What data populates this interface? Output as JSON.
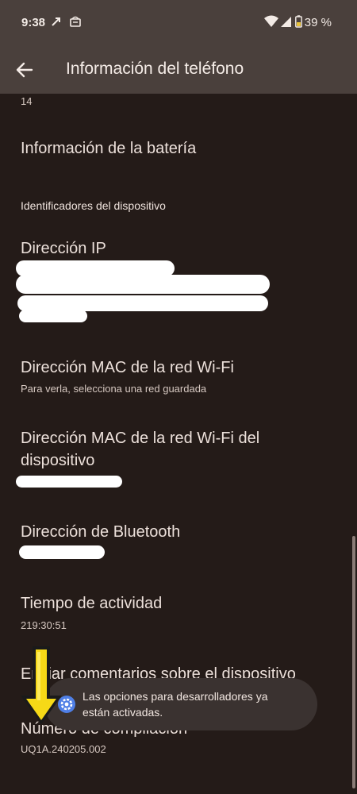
{
  "status_bar": {
    "time": "9:38",
    "battery_percent": "39 %"
  },
  "app_bar": {
    "title": "Información del teléfono"
  },
  "list": {
    "partial_value": "14",
    "battery_info": "Información de la batería",
    "section_header": "Identificadores del dispositivo",
    "ip_address": "Dirección IP",
    "wifi_mac": "Dirección MAC de la red Wi-Fi",
    "wifi_mac_summary": "Para verla, selecciona una red guardada",
    "device_wifi_mac_line1": "Dirección MAC de la red Wi-Fi del",
    "device_wifi_mac_line2": "dispositivo",
    "bluetooth_address": "Dirección de Bluetooth",
    "uptime": "Tiempo de actividad",
    "uptime_value": "219:30:51",
    "feedback": "Enviar comentarios sobre el dispositivo",
    "build_number": "Número de compilación",
    "build_value": "UQ1A.240205.002"
  },
  "toast": {
    "line1": "Las opciones para desarrolladores ya",
    "line2": "están activadas."
  },
  "colors": {
    "background": "#241b18",
    "app_bar": "#4a403c",
    "toast": "#3a3230",
    "accent_blue": "#4f7fe6",
    "arrow_yellow": "#f6d917"
  }
}
